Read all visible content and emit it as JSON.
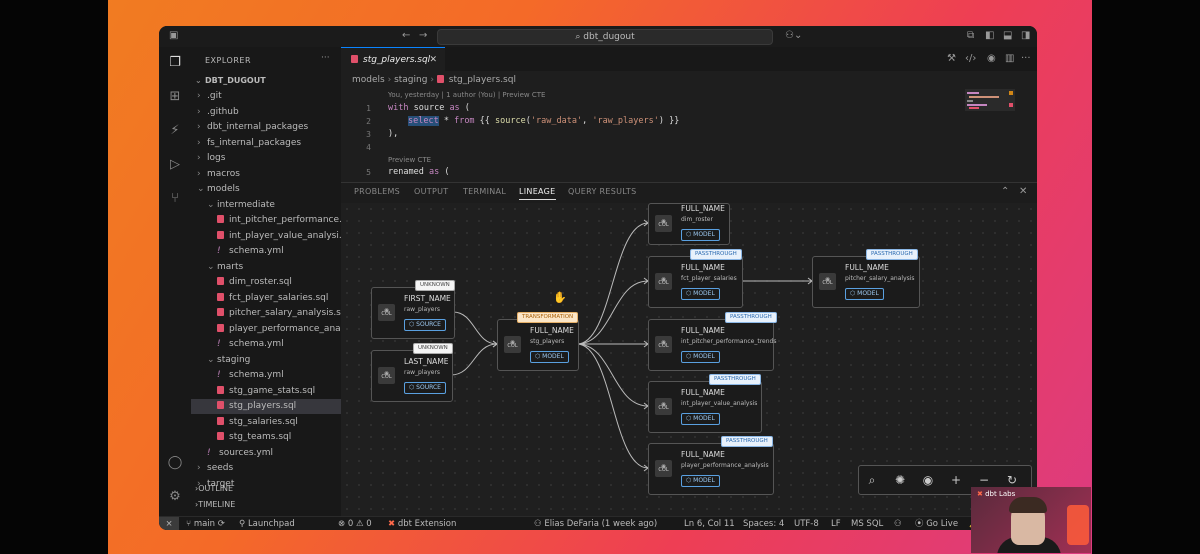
{
  "window": {
    "search_label": "dbt_dugout",
    "title_icons": [
      "sidebar-left-icon",
      "back-arrow-icon",
      "forward-arrow-icon",
      "copilot-icon"
    ]
  },
  "explorer": {
    "title": "EXPLORER",
    "root": "DBT_DUGOUT",
    "items": [
      {
        "label": ".git",
        "type": "folder",
        "indent": 1
      },
      {
        "label": ".github",
        "type": "folder",
        "indent": 1
      },
      {
        "label": "dbt_internal_packages",
        "type": "folder",
        "indent": 1
      },
      {
        "label": "fs_internal_packages",
        "type": "folder",
        "indent": 1
      },
      {
        "label": "logs",
        "type": "folder",
        "indent": 1
      },
      {
        "label": "macros",
        "type": "folder",
        "indent": 1
      },
      {
        "label": "models",
        "type": "folder-open",
        "indent": 1
      },
      {
        "label": "intermediate",
        "type": "folder-open",
        "indent": 2
      },
      {
        "label": "int_pitcher_performance...",
        "type": "sql",
        "indent": 3
      },
      {
        "label": "int_player_value_analysi...",
        "type": "sql",
        "indent": 3
      },
      {
        "label": "schema.yml",
        "type": "yml",
        "indent": 3
      },
      {
        "label": "marts",
        "type": "folder-open",
        "indent": 2
      },
      {
        "label": "dim_roster.sql",
        "type": "sql",
        "indent": 3
      },
      {
        "label": "fct_player_salaries.sql",
        "type": "sql",
        "indent": 3
      },
      {
        "label": "pitcher_salary_analysis.sql",
        "type": "sql",
        "indent": 3
      },
      {
        "label": "player_performance_ana...",
        "type": "sql",
        "indent": 3
      },
      {
        "label": "schema.yml",
        "type": "yml",
        "indent": 3
      },
      {
        "label": "staging",
        "type": "folder-open",
        "indent": 2
      },
      {
        "label": "schema.yml",
        "type": "yml",
        "indent": 3
      },
      {
        "label": "stg_game_stats.sql",
        "type": "sql",
        "indent": 3
      },
      {
        "label": "stg_players.sql",
        "type": "sql",
        "indent": 3,
        "selected": true
      },
      {
        "label": "stg_salaries.sql",
        "type": "sql",
        "indent": 3
      },
      {
        "label": "stg_teams.sql",
        "type": "sql",
        "indent": 3
      },
      {
        "label": "sources.yml",
        "type": "yml",
        "indent": 2
      },
      {
        "label": "seeds",
        "type": "folder",
        "indent": 1
      },
      {
        "label": "target",
        "type": "folder",
        "indent": 1
      }
    ],
    "outline": "OUTLINE",
    "timeline": "TIMELINE"
  },
  "editor": {
    "tab_label": "stg_players.sql",
    "breadcrumb": [
      "models",
      "staging",
      "stg_players.sql"
    ],
    "codelens_1": "You, yesterday | 1 author (You) | Preview CTE",
    "codelens_2": "Preview CTE",
    "lines": [
      {
        "n": "1"
      },
      {
        "n": "2"
      },
      {
        "n": "3"
      },
      {
        "n": "4"
      },
      {
        "n": "5"
      }
    ],
    "code": {
      "l1_kw": "with",
      "l1_rest": " source ",
      "l1_as": "as",
      "l1_paren": " (",
      "l2_select": "select",
      "l2_star": " * ",
      "l2_from": "from",
      "l2_open": " {{ ",
      "l2_fn": "source",
      "l2_args1": "(",
      "l2_str1": "'raw_data'",
      "l2_comma": ", ",
      "l2_str2": "'raw_players'",
      "l2_close": ") }}",
      "l3": "),",
      "l5_name": "renamed ",
      "l5_as": "as",
      "l5_paren": " ("
    }
  },
  "panel": {
    "tabs": [
      "PROBLEMS",
      "OUTPUT",
      "TERMINAL",
      "LINEAGE",
      "QUERY RESULTS"
    ],
    "active_tab": "LINEAGE"
  },
  "lineage": {
    "col_label": "COL",
    "nodes": [
      {
        "id": "first_name",
        "name": "FIRST_NAME",
        "sub": "raw_players",
        "button": "SOURCE",
        "badge": "UNKNOWN",
        "badge_style": "white"
      },
      {
        "id": "last_name",
        "name": "LAST_NAME",
        "sub": "raw_players",
        "button": "SOURCE",
        "badge": "UNKNOWN",
        "badge_style": "white"
      },
      {
        "id": "stg",
        "name": "FULL_NAME",
        "sub": "stg_players",
        "button": "MODEL",
        "badge": "TRANSFORMATION",
        "badge_style": "orange"
      },
      {
        "id": "dim_roster",
        "name": "FULL_NAME",
        "sub": "dim_roster",
        "button": "MODEL",
        "badge": "",
        "badge_style": "blue"
      },
      {
        "id": "fct",
        "name": "FULL_NAME",
        "sub": "fct_player_salaries",
        "button": "MODEL",
        "badge": "PASSTHROUGH",
        "badge_style": "blue"
      },
      {
        "id": "pitcher_salary",
        "name": "FULL_NAME",
        "sub": "pitcher_salary_analysis",
        "button": "MODEL",
        "badge": "PASSTHROUGH",
        "badge_style": "blue"
      },
      {
        "id": "int_pitcher",
        "name": "FULL_NAME",
        "sub": "int_pitcher_performance_trends",
        "button": "MODEL",
        "badge": "PASSTHROUGH",
        "badge_style": "blue"
      },
      {
        "id": "int_value",
        "name": "FULL_NAME",
        "sub": "int_player_value_analysis",
        "button": "MODEL",
        "badge": "PASSTHROUGH",
        "badge_style": "blue"
      },
      {
        "id": "perf",
        "name": "FULL_NAME",
        "sub": "player_performance_analysis",
        "button": "MODEL",
        "badge": "PASSTHROUGH",
        "badge_style": "blue"
      }
    ],
    "toolbar": [
      "search-icon",
      "openai-icon",
      "eye-icon",
      "plus-icon",
      "minus-icon",
      "refresh-icon"
    ]
  },
  "statusbar": {
    "branch": "main",
    "launchpad": "Launchpad",
    "errors": "0",
    "warnings": "0",
    "extension": "dbt Extension",
    "blame": "Elias DeFaria (1 week ago)",
    "position": "Ln 6, Col 11",
    "spaces": "Spaces: 4",
    "encoding": "UTF-8",
    "eol": "LF",
    "language": "MS SQL",
    "golive": "Go Live"
  },
  "webcam": {
    "logo": "dbt Labs"
  }
}
